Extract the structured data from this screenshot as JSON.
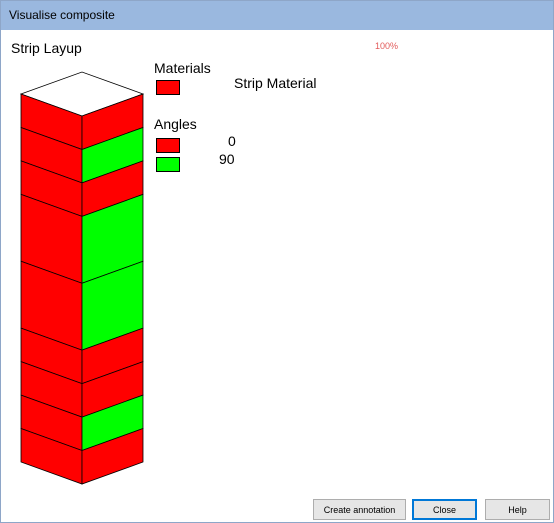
{
  "window": {
    "title": "Visualise composite"
  },
  "main": {
    "heading": "Strip Layup",
    "zoom": "100%"
  },
  "legend": {
    "materials_title": "Materials",
    "materials": [
      {
        "label": "Strip Material",
        "color": "#ff0000"
      }
    ],
    "angles_title": "Angles",
    "angles": [
      {
        "label": "0",
        "color": "#ff0000"
      },
      {
        "label": "90",
        "color": "#00ff00"
      }
    ]
  },
  "layup": {
    "colors": {
      "0": "#ff0000",
      "90": "#00ff00",
      "top": "#ffffff",
      "edge": "#000000"
    },
    "plies": [
      {
        "angle": "0",
        "thickness": 1
      },
      {
        "angle": "90",
        "thickness": 1
      },
      {
        "angle": "0",
        "thickness": 1
      },
      {
        "angle": "90",
        "thickness": 2
      },
      {
        "angle": "90",
        "thickness": 2
      },
      {
        "angle": "0",
        "thickness": 1
      },
      {
        "angle": "0",
        "thickness": 1
      },
      {
        "angle": "90",
        "thickness": 1
      },
      {
        "angle": "0",
        "thickness": 1
      }
    ]
  },
  "buttons": {
    "create_annotation": "Create annotation",
    "close": "Close",
    "help": "Help"
  }
}
